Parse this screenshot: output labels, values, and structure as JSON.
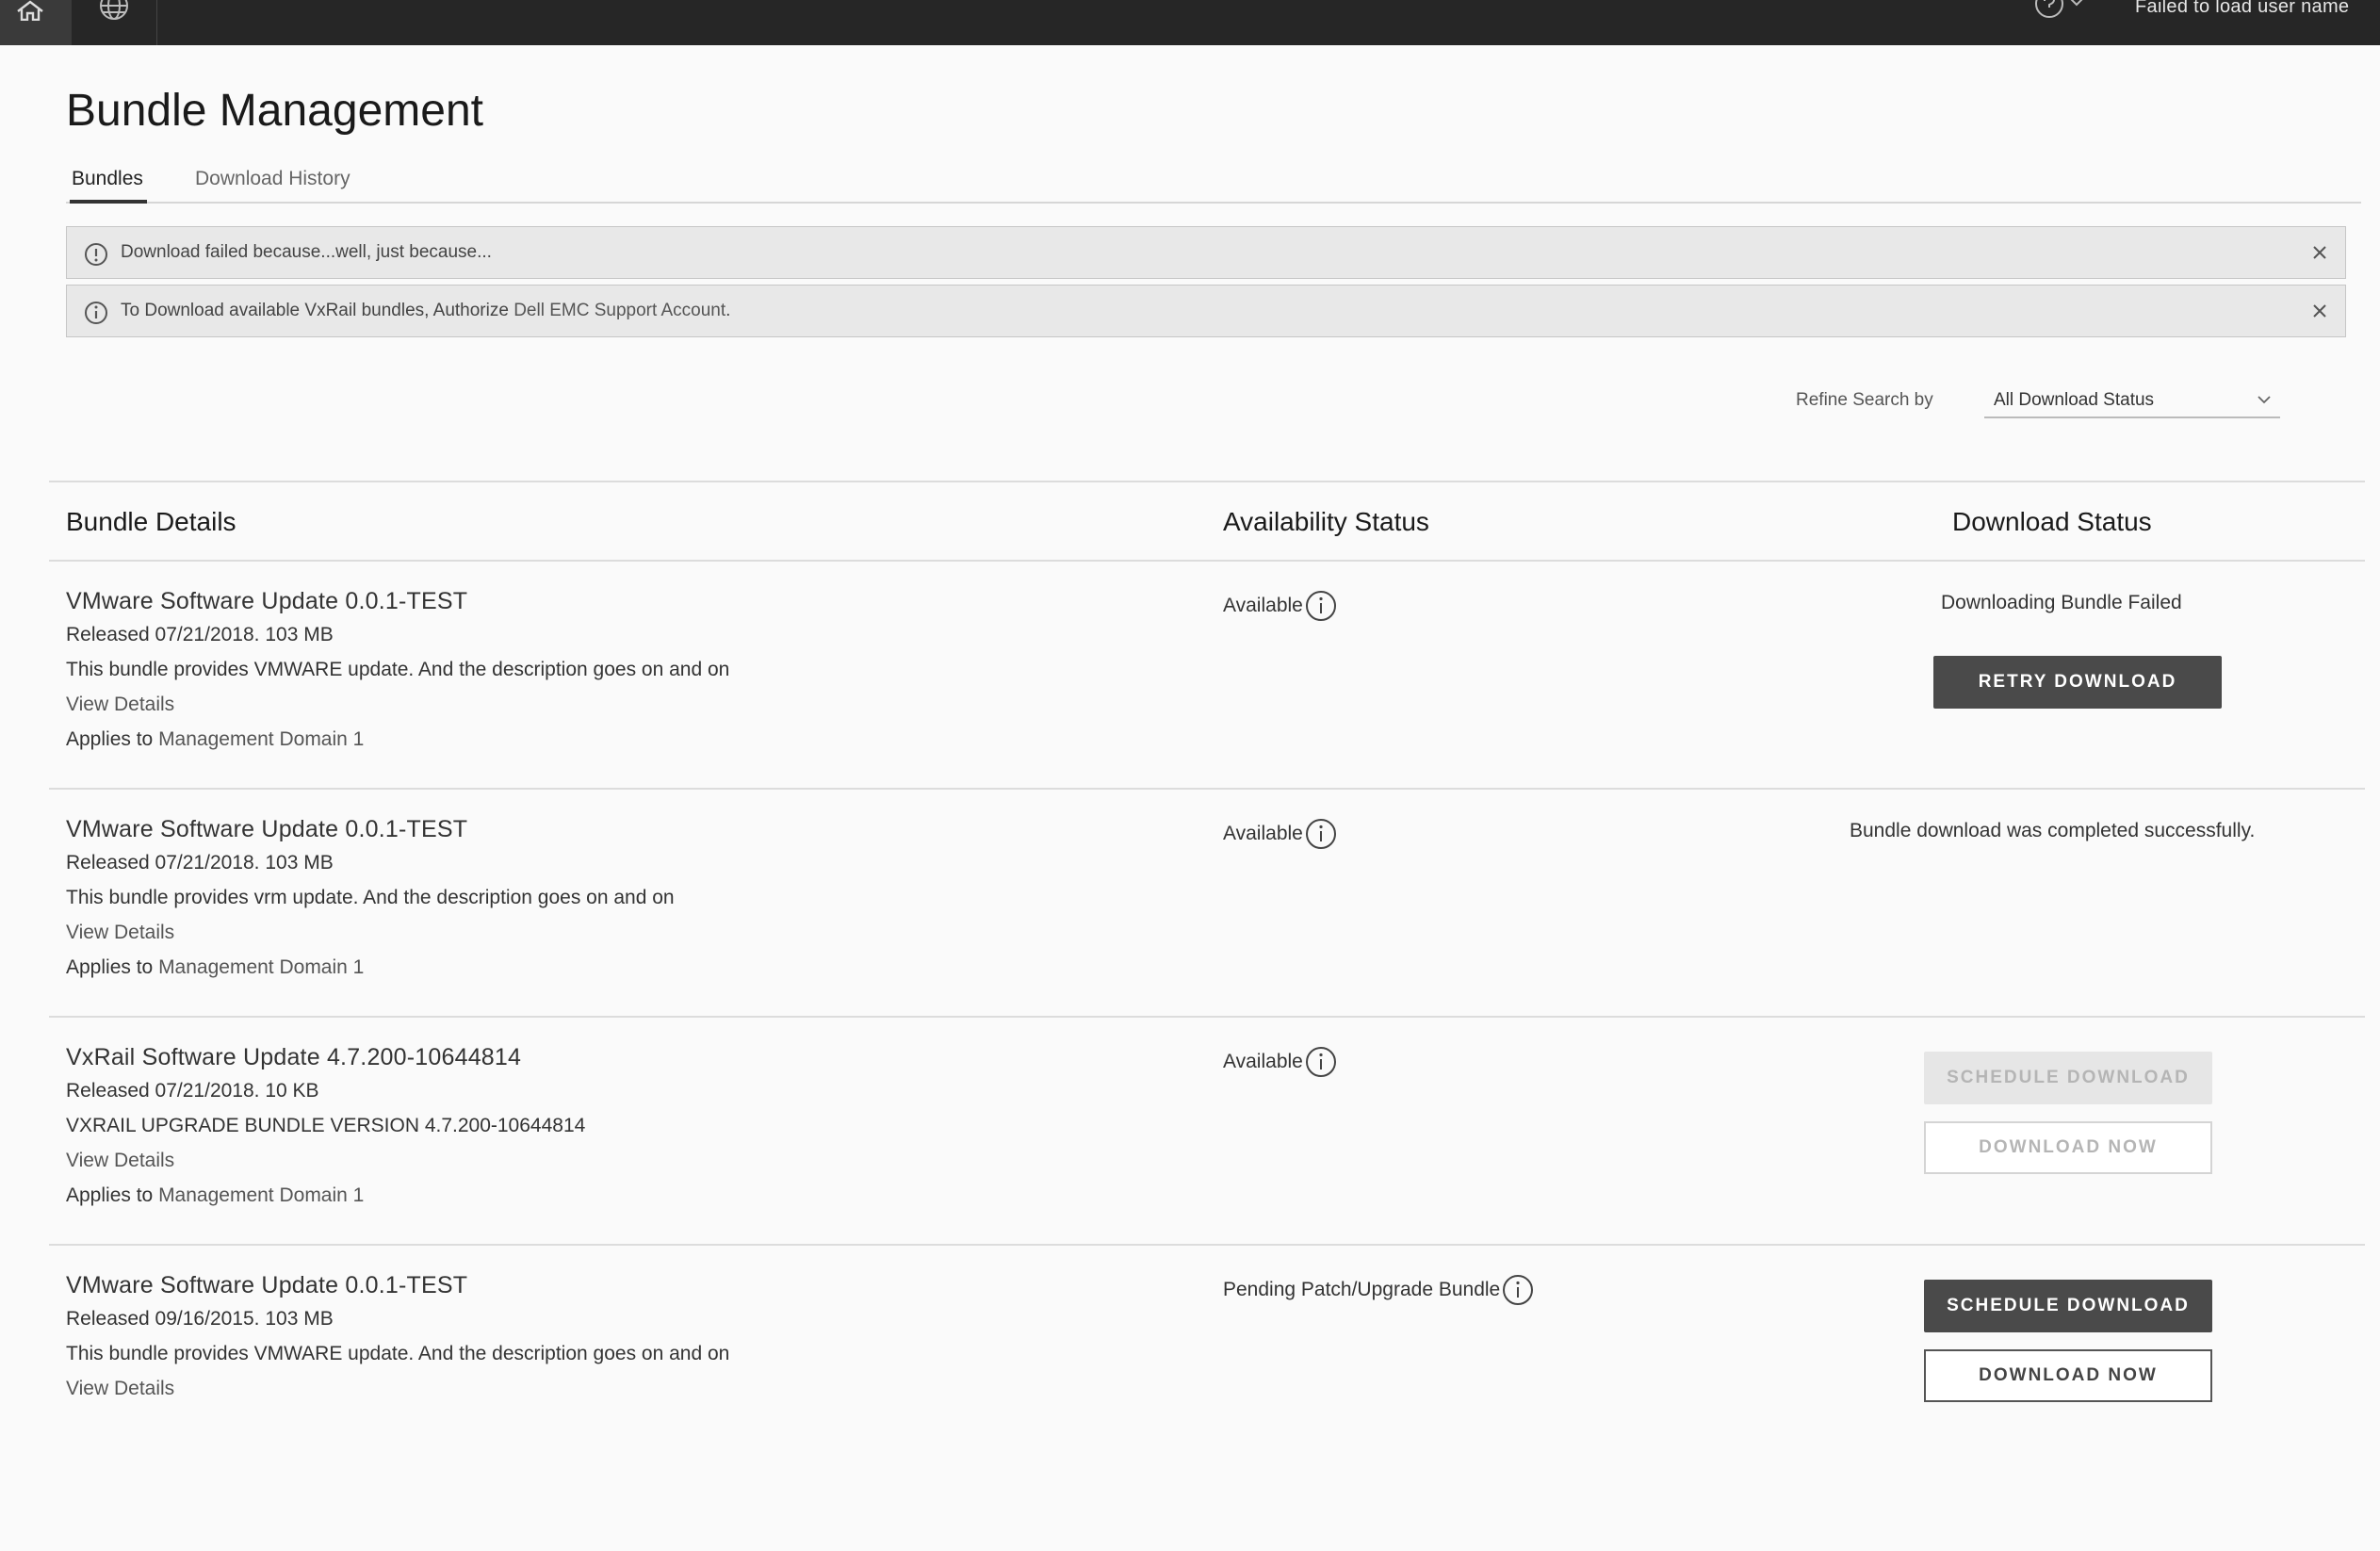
{
  "topbar": {
    "home_icon": "home-icon",
    "globe_icon": "globe-icon",
    "help_icon": "help-icon",
    "user_text": "Failed to load user name"
  },
  "page": {
    "title": "Bundle Management"
  },
  "tabs": [
    {
      "label": "Bundles",
      "active": true
    },
    {
      "label": "Download History",
      "active": false
    }
  ],
  "alerts": [
    {
      "message": "Download failed because...well, just because..."
    },
    {
      "message_prefix": "To Download available VxRail bundles, Authorize ",
      "link": "Dell EMC Support Account",
      "message_suffix": "."
    }
  ],
  "filter": {
    "label": "Refine Search by",
    "selected": "All Download Status"
  },
  "table": {
    "headers": {
      "details": "Bundle Details",
      "availability": "Availability Status",
      "download": "Download Status"
    },
    "rows": [
      {
        "name": "VMware Software Update 0.0.1-TEST",
        "released": "Released 07/21/2018. 103 MB",
        "description": "This bundle provides VMWARE update. And the description goes on and on",
        "view_details": "View Details",
        "applies_prefix": "Applies to ",
        "applies_link": "Management Domain 1",
        "availability": "Available",
        "download_status": "Downloading Bundle Failed",
        "retry_label": "RETRY DOWNLOAD"
      },
      {
        "name": "VMware Software Update 0.0.1-TEST",
        "released": "Released 07/21/2018. 103 MB",
        "description": "This bundle provides vrm update. And the description goes on and on",
        "view_details": "View Details",
        "applies_prefix": "Applies to ",
        "applies_link": "Management Domain 1",
        "availability": "Available",
        "download_status": "Bundle download was completed successfully."
      },
      {
        "name": "VxRail Software Update 4.7.200-10644814",
        "released": "Released 07/21/2018. 10 KB",
        "description": "VXRAIL UPGRADE BUNDLE VERSION 4.7.200-10644814",
        "view_details": "View Details",
        "applies_prefix": "Applies to ",
        "applies_link": "Management Domain 1",
        "availability": "Available",
        "schedule_label": "SCHEDULE DOWNLOAD",
        "download_now_label": "DOWNLOAD NOW"
      },
      {
        "name": "VMware Software Update 0.0.1-TEST",
        "released": "Released 09/16/2015. 103 MB",
        "description": "This bundle provides VMWARE update. And the description goes on and on",
        "view_details": "View Details",
        "availability": "Pending Patch/Upgrade Bundle",
        "schedule_label": "SCHEDULE DOWNLOAD",
        "download_now_label": "DOWNLOAD NOW"
      }
    ]
  },
  "colors": {
    "topbar": "#262626",
    "button_dark": "#4a4a4a",
    "page_bg": "#fafafa"
  }
}
